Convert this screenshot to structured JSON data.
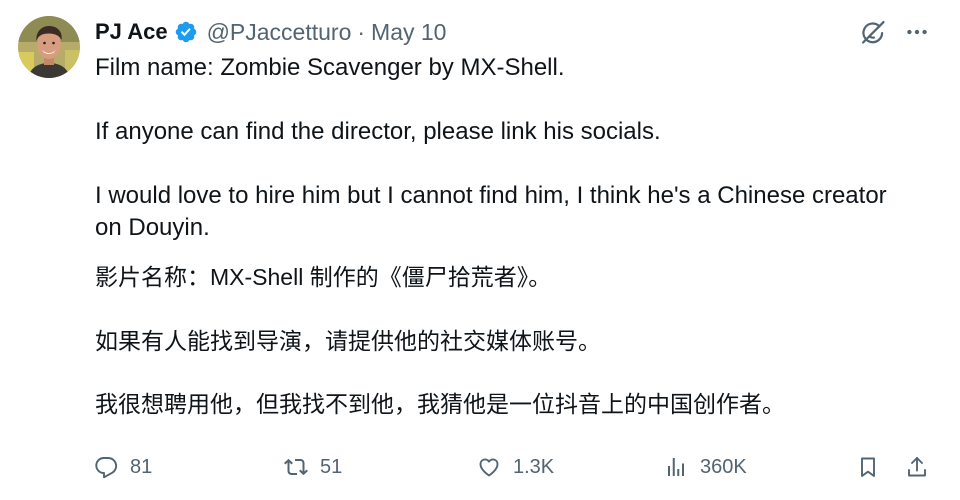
{
  "tweet": {
    "author": {
      "name": "PJ Ace",
      "handle": "@PJaccetturo",
      "separator": "·",
      "date": "May 10",
      "verified": true
    },
    "header_icons": {
      "grok": "grok-icon",
      "more": "more-icon"
    },
    "text_en": [
      [
        "Film name: Zombie Scavenger by MX-Shell."
      ],
      [
        "If anyone can find the director, please link his socials."
      ],
      [
        "I would love to hire him but I cannot find him, I think he's a Chinese creator",
        "on Douyin."
      ]
    ],
    "text_zh": [
      "影片名称：MX-Shell 制作的《僵尸拾荒者》。",
      "如果有人能找到导演，请提供他的社交媒体账号。",
      "我很想聘用他，但我找不到他，我猜他是一位抖音上的中国创作者。"
    ],
    "actions": {
      "reply": {
        "icon": "reply-icon",
        "count": "81"
      },
      "retweet": {
        "icon": "retweet-icon",
        "count": "51"
      },
      "like": {
        "icon": "heart-icon",
        "count": "1.3K"
      },
      "views": {
        "icon": "views-icon",
        "count": "360K"
      },
      "bookmark": {
        "icon": "bookmark-icon"
      },
      "share": {
        "icon": "share-icon"
      }
    }
  },
  "colors": {
    "text": "#0f1419",
    "secondary": "#536471",
    "verified": "#1d9bf0",
    "background": "#ffffff"
  }
}
